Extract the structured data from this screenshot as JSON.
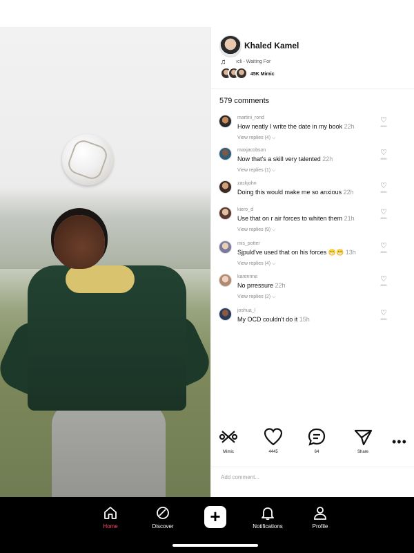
{
  "creator": {
    "name": "Khaled Kamel",
    "music_icon": "music-note-icon",
    "music_text": "ıcli - Waiting For",
    "mimic_count": "45K Mimic"
  },
  "comments_header": "579 comments",
  "comments": [
    {
      "user": "martini_rond",
      "text": "How neatly I write the date in my book",
      "time": "22h",
      "replies": "View replies (4)",
      "likes": "8098"
    },
    {
      "user": "maxjacobson",
      "text": "Now that's a skill very talented",
      "time": "22h",
      "replies": "View replies (1)",
      "likes": "8098"
    },
    {
      "user": "zackjohn",
      "text": "Doing this would make me so anxious",
      "time": "22h",
      "replies": "",
      "likes": "8098"
    },
    {
      "user": "kiero_d",
      "text": "Use that on r air forces to whiten them",
      "time": "21h",
      "replies": "View replies (9)",
      "likes": "8098"
    },
    {
      "user": "mis_potter",
      "text": "Sjpuld've used that on his forces 😁😁",
      "time": "13h",
      "replies": "View replies (4)",
      "likes": "8098"
    },
    {
      "user": "karennne",
      "text": "No prressure",
      "time": "22h",
      "replies": "View replies (2)",
      "likes": "8098"
    },
    {
      "user": "joshua_l",
      "text": "My OCD couldn't do it",
      "time": "15h",
      "replies": "",
      "likes": "8098"
    }
  ],
  "actions": {
    "mimic_label": "Mimic",
    "likes_count": "4445",
    "comments_count": "64",
    "share_label": "Share"
  },
  "add_comment_placeholder": "Add comment...",
  "nav": {
    "home": "Home",
    "discover": "Discover",
    "notifications": "Notifications",
    "profile": "Profile"
  },
  "colors": {
    "active_nav": "#ff4d6d",
    "nav_background": "#000000"
  }
}
